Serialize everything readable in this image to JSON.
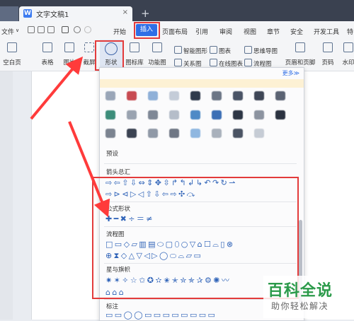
{
  "window": {
    "tab_title": "文字文稿1",
    "tab_close": "×",
    "new_tab": "+",
    "doc_icon": "W"
  },
  "menubar": {
    "file_label": "文件",
    "file_caret": "∨",
    "items": [
      "开始",
      "插入",
      "页面布局",
      "引用",
      "审阅",
      "视图",
      "章节",
      "安全",
      "开发工具",
      "特"
    ],
    "active": "插入"
  },
  "ribbon": {
    "items": [
      {
        "label": "空白页"
      },
      {
        "label": "表格"
      },
      {
        "label": "图片"
      },
      {
        "label": "截屏"
      },
      {
        "label": "形状"
      },
      {
        "label": "图标库"
      },
      {
        "label": "功能图"
      }
    ],
    "small": {
      "smart_art": "智能图形",
      "chart": "图表",
      "mind_map": "思维导图",
      "relation": "关系图",
      "online_chart": "在线图表",
      "flowchart": "流程图"
    },
    "right": [
      {
        "label": "页眉和页脚"
      },
      {
        "label": "页码"
      },
      {
        "label": "水印"
      }
    ]
  },
  "shapes_panel": {
    "more_link": "更多≫",
    "sections": {
      "preset": "预设",
      "arrows": "箭头总汇",
      "formula": "公式形状",
      "flowchart": "流程图",
      "stars": "星与旗帜",
      "callouts": "标注"
    },
    "rows": {
      "arrows_1": "⇨⇦⇧⇩⇔⇕✥⇳↱↰↲↳↶↷↻⇀",
      "arrows_2": "⇨⊳⊲▷◁⇧⇩⇦⇨✣⤼",
      "formula": "✚━✖÷＝≠",
      "flow_1": "□▭◇▱▥▤⬭▢⬯○▽⌂☐⌓▯⊗",
      "flow_2": "⊕⧗◇△▽◁▷◯⬭⌓▱▭",
      "stars_1": "✷✶✧☆✩✪✫✬✭✮✯✰⚙✺〰",
      "stars_2": "⌂⌂⌂",
      "callouts": "▭▭◯◯▭▭▭▭▭▭▭▭"
    }
  },
  "watermark": {
    "title": "百科全说",
    "subtitle": "助你轻松解决"
  },
  "colors": {
    "accent": "#2f6ee6",
    "highlight": "#e33b3b",
    "watermark_green": "#2b9a4a"
  }
}
